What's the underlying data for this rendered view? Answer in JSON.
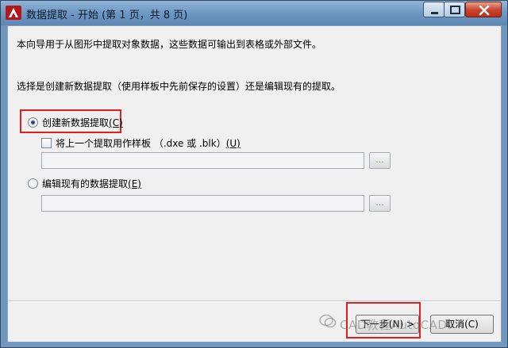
{
  "window": {
    "title": "数据提取 - 开始 (第 1 页，共 8 页)"
  },
  "content": {
    "intro": "本向导用于从图形中提取对象数据，这些数据可输出到表格或外部文件。",
    "question": "选择是创建新数据提取（使用样板中先前保存的设置）还是编辑现有的提取。"
  },
  "options": {
    "create": {
      "label": "创建新数据提取",
      "key": "(C)",
      "selected": true
    },
    "template": {
      "label": "将上一个提取用作样板  （.dxe 或 .blk）",
      "key": "(U)",
      "checked": false
    },
    "edit": {
      "label": "编辑现有的数据提取",
      "key": "(E)",
      "selected": false
    }
  },
  "inputs": {
    "template_path": "",
    "edit_path": ""
  },
  "browse_label": "...",
  "buttons": {
    "next": "下一步(N) >",
    "cancel": "取消(C)"
  },
  "watermark": "CAD教程AutoCAD",
  "colors": {
    "highlight": "#e02020",
    "titlebar": "#6c95bf",
    "close": "#c5432b"
  }
}
